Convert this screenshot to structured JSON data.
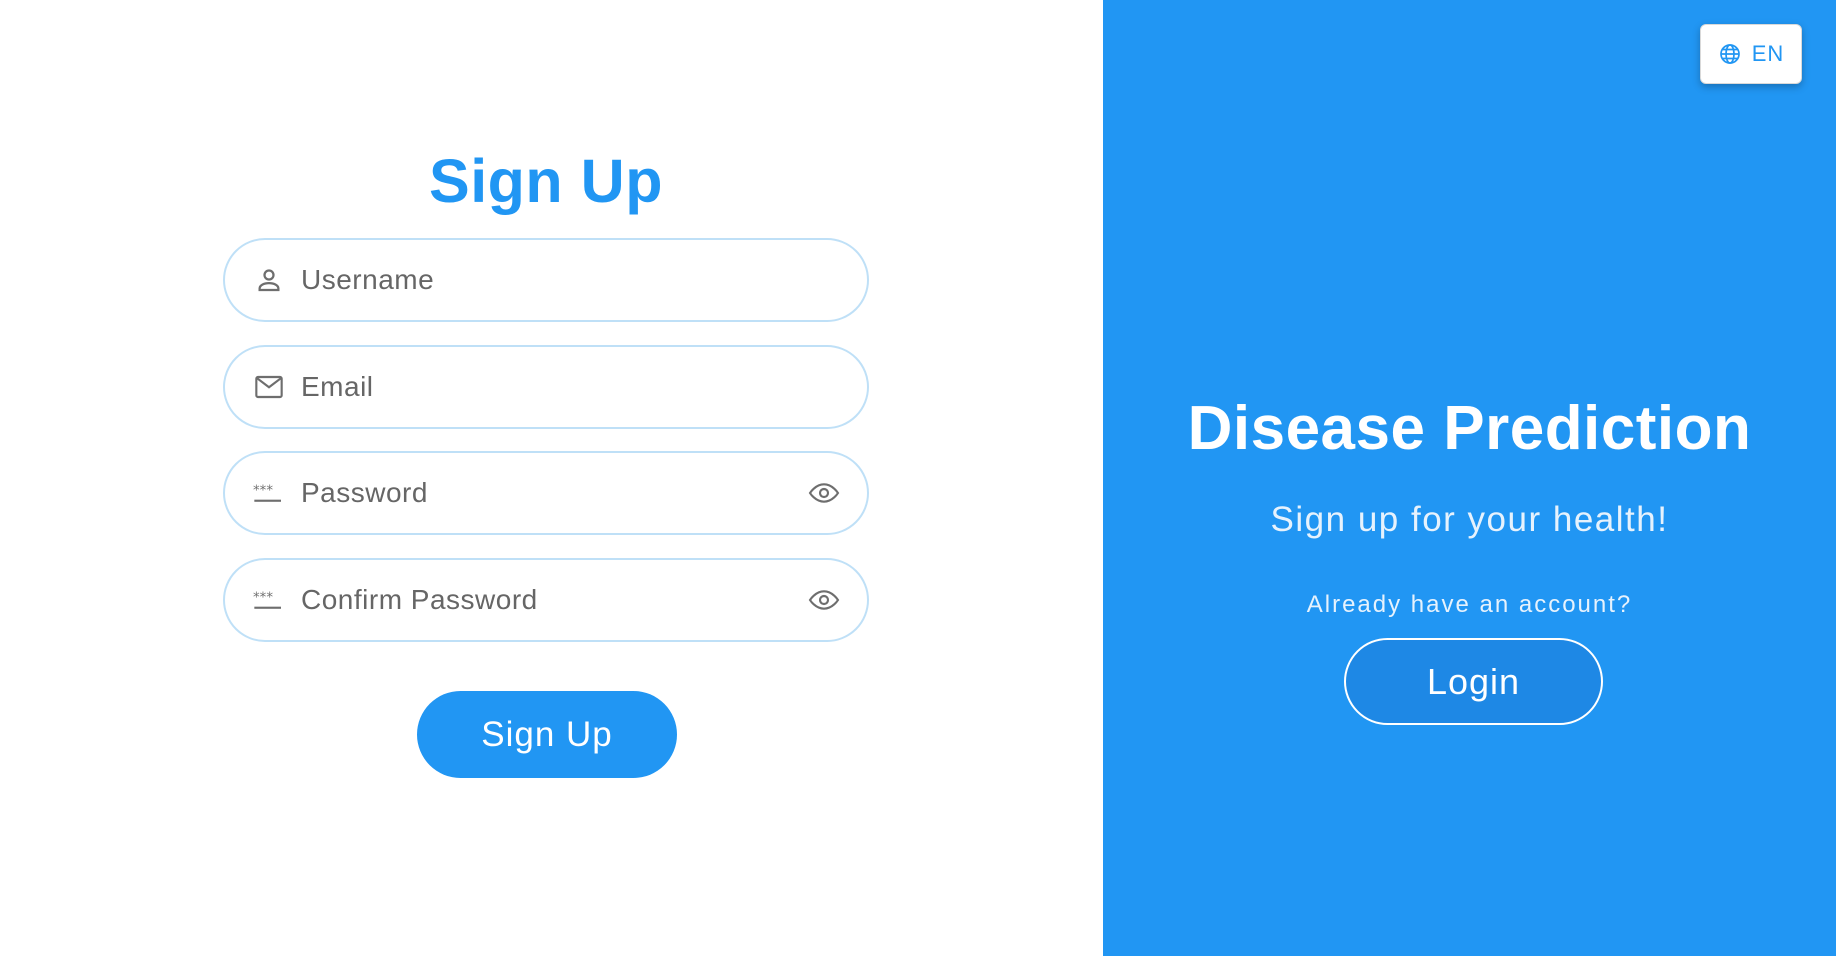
{
  "signup_form": {
    "title": "Sign Up",
    "fields": {
      "username": {
        "placeholder": "Username",
        "icon": "user-icon"
      },
      "email": {
        "placeholder": "Email",
        "icon": "mail-icon"
      },
      "password": {
        "placeholder": "Password",
        "icon": "password-icon",
        "toggle_icon": "eye-icon"
      },
      "confirm_password": {
        "placeholder": "Confirm Password",
        "icon": "password-icon",
        "toggle_icon": "eye-icon"
      }
    },
    "submit_label": "Sign Up"
  },
  "info_panel": {
    "language_button": {
      "label": "EN",
      "icon": "globe-icon"
    },
    "title": "Disease Prediction",
    "subtitle": "Sign up for your health!",
    "account_prompt": "Already have an account?",
    "login_label": "Login"
  },
  "colors": {
    "accent": "#2196f3",
    "field_border": "#bfe0f7",
    "placeholder_text": "#666666",
    "panel_text": "#ffffff"
  }
}
